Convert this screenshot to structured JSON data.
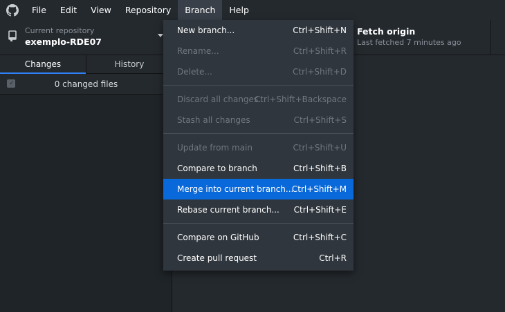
{
  "menubar": {
    "items": [
      "File",
      "Edit",
      "View",
      "Repository",
      "Branch",
      "Help"
    ]
  },
  "toolbar": {
    "repo_caption": "Current repository",
    "repo_name": "exemplo-RDE07",
    "fetch_title": "Fetch origin",
    "fetch_sub": "Last fetched 7 minutes ago"
  },
  "tabs": {
    "changes": "Changes",
    "history": "History"
  },
  "changes": {
    "count_label": "0 changed files"
  },
  "branch_menu": {
    "items": [
      {
        "label": "New branch...",
        "accel": "Ctrl+Shift+N"
      },
      {
        "label": "Rename...",
        "accel": "Ctrl+Shift+R"
      },
      {
        "label": "Delete...",
        "accel": "Ctrl+Shift+D"
      },
      {
        "label": "Discard all changes...",
        "accel": "Ctrl+Shift+Backspace"
      },
      {
        "label": "Stash all changes",
        "accel": "Ctrl+Shift+S"
      },
      {
        "label": "Update from main",
        "accel": "Ctrl+Shift+U"
      },
      {
        "label": "Compare to branch",
        "accel": "Ctrl+Shift+B"
      },
      {
        "label": "Merge into current branch...",
        "accel": "Ctrl+Shift+M"
      },
      {
        "label": "Rebase current branch...",
        "accel": "Ctrl+Shift+E"
      },
      {
        "label": "Compare on GitHub",
        "accel": "Ctrl+Shift+C"
      },
      {
        "label": "Create pull request",
        "accel": "Ctrl+R"
      }
    ]
  },
  "colors": {
    "highlight": "#0969da",
    "menu_bg": "#2f363d",
    "app_bg": "#24292e"
  },
  "icons": [
    "github-logo-icon",
    "repo-icon",
    "caret-down-icon",
    "checkbox-icon"
  ]
}
